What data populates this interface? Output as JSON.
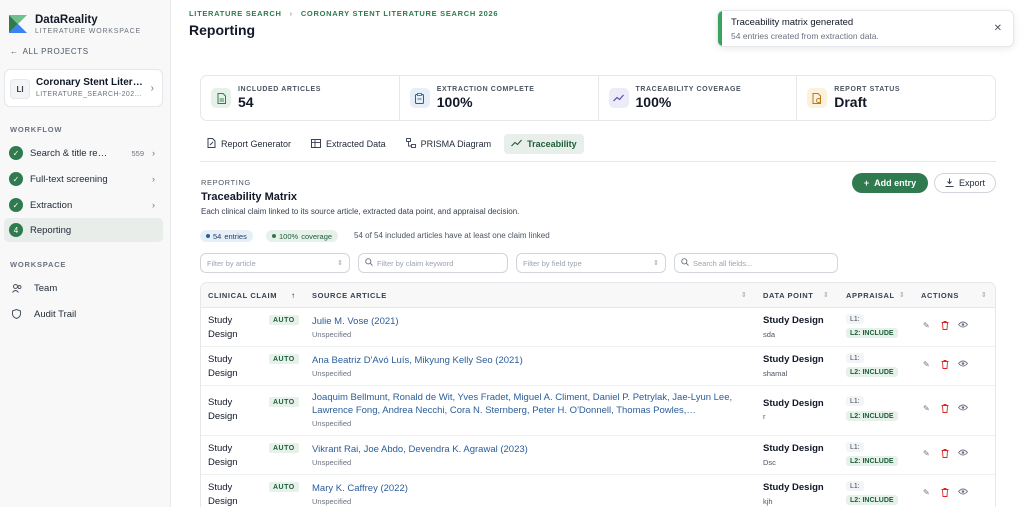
{
  "brand": {
    "name": "DataReality",
    "subtitle": "LITERATURE WORKSPACE"
  },
  "sidebar": {
    "back_label": "ALL PROJECTS",
    "project": {
      "avatar": "LI",
      "name": "Coronary Stent Litera…",
      "id": "LITERATURE_SEARCH-202…"
    },
    "workflow_label": "WORKFLOW",
    "workflow": [
      {
        "label": "Search & title re…",
        "count": "559",
        "state": "done"
      },
      {
        "label": "Full-text screening",
        "count": "",
        "state": "done"
      },
      {
        "label": "Extraction",
        "count": "",
        "state": "done"
      },
      {
        "label": "Reporting",
        "step": "4",
        "state": "active"
      }
    ],
    "workspace_label": "WORKSPACE",
    "workspace": [
      {
        "label": "Team",
        "icon": "team-icon"
      },
      {
        "label": "Audit Trail",
        "icon": "shield-icon"
      }
    ]
  },
  "header": {
    "breadcrumb": [
      "LITERATURE SEARCH",
      "CORONARY STENT LITERATURE SEARCH 2026"
    ],
    "title": "Reporting"
  },
  "stats": [
    {
      "label": "INCLUDED ARTICLES",
      "value": "54",
      "icon": "document-icon",
      "color": "#2f7a4f",
      "bg": "#e6f1ea"
    },
    {
      "label": "EXTRACTION COMPLETE",
      "value": "100%",
      "icon": "clipboard-icon",
      "color": "#2b5d9a",
      "bg": "#e6eef7"
    },
    {
      "label": "TRACEABILITY COVERAGE",
      "value": "100%",
      "icon": "trend-icon",
      "color": "#4f46a5",
      "bg": "#ecebf8"
    },
    {
      "label": "REPORT STATUS",
      "value": "Draft",
      "icon": "report-icon",
      "color": "#b7791f",
      "bg": "#fbf1dc"
    }
  ],
  "tabs": [
    {
      "label": "Report Generator",
      "icon": "file-edit-icon"
    },
    {
      "label": "Extracted Data",
      "icon": "table-icon"
    },
    {
      "label": "PRISMA Diagram",
      "icon": "flow-icon"
    },
    {
      "label": "Traceability",
      "icon": "trend-icon",
      "active": true
    }
  ],
  "section": {
    "kicker": "REPORTING",
    "title": "Traceability Matrix",
    "description": "Each clinical claim linked to its source article, extracted data point, and appraisal decision.",
    "add_label": "Add entry",
    "export_label": "Export"
  },
  "summary": {
    "entries_count": "54",
    "entries_label": "entries",
    "coverage_value": "100%",
    "coverage_label": "coverage",
    "note": "54 of 54 included articles have at least one claim linked"
  },
  "filters": {
    "article_placeholder": "Filter by article",
    "keyword_placeholder": "Filter by claim keyword",
    "field_placeholder": "Filter by field type",
    "search_placeholder": "Search all fields..."
  },
  "table": {
    "headers": {
      "claim": "CLINICAL CLAIM",
      "source": "SOURCE ARTICLE",
      "datapoint": "DATA POINT",
      "appraisal": "APPRAISAL",
      "actions": "ACTIONS"
    },
    "rows": [
      {
        "claim": "Study Design",
        "badge": "AUTO",
        "source": "Julie M. Vose (2021)",
        "source_sub": "Unspecified",
        "dp_title": "Study Design",
        "dp_value": "sda",
        "l1": "L1:",
        "l2": "L2: INCLUDE"
      },
      {
        "claim": "Study Design",
        "badge": "AUTO",
        "source": "Ana Beatriz D'Avó Luís, Mikyung Kelly Seo (2021)",
        "source_sub": "Unspecified",
        "dp_title": "Study Design",
        "dp_value": "shamal",
        "l1": "L1:",
        "l2": "L2: INCLUDE"
      },
      {
        "claim": "Study Design",
        "badge": "AUTO",
        "source": "Joaquim Bellmunt, Ronald de Wit, Yves Fradet, Miguel A. Climent, Daniel P. Petrylak, Jae-Lyun Lee, Lawrence Fong, Andrea Necchi, Cora N. Sternberg, Peter H. O'Donnell, Thomas Powles,…",
        "source_sub": "Unspecified",
        "dp_title": "Study Design",
        "dp_value": "r",
        "l1": "L1:",
        "l2": "L2: INCLUDE"
      },
      {
        "claim": "Study Design",
        "badge": "AUTO",
        "source": "Vikrant Rai, Joe Abdo, Devendra K. Agrawal (2023)",
        "source_sub": "Unspecified",
        "dp_title": "Study Design",
        "dp_value": "Dsc",
        "l1": "L1:",
        "l2": "L2: INCLUDE"
      },
      {
        "claim": "Study Design",
        "badge": "AUTO",
        "source": "Mary K. Caffrey (2022)",
        "source_sub": "Unspecified",
        "dp_title": "Study Design",
        "dp_value": "kjh",
        "l1": "L1:",
        "l2": "L2: INCLUDE"
      }
    ]
  },
  "toast": {
    "title": "Traceability matrix generated",
    "message": "54 entries created from extraction data."
  },
  "colors": {
    "accent": "#2f7a4f",
    "link": "#2b5d9a",
    "danger": "#dc2626"
  }
}
